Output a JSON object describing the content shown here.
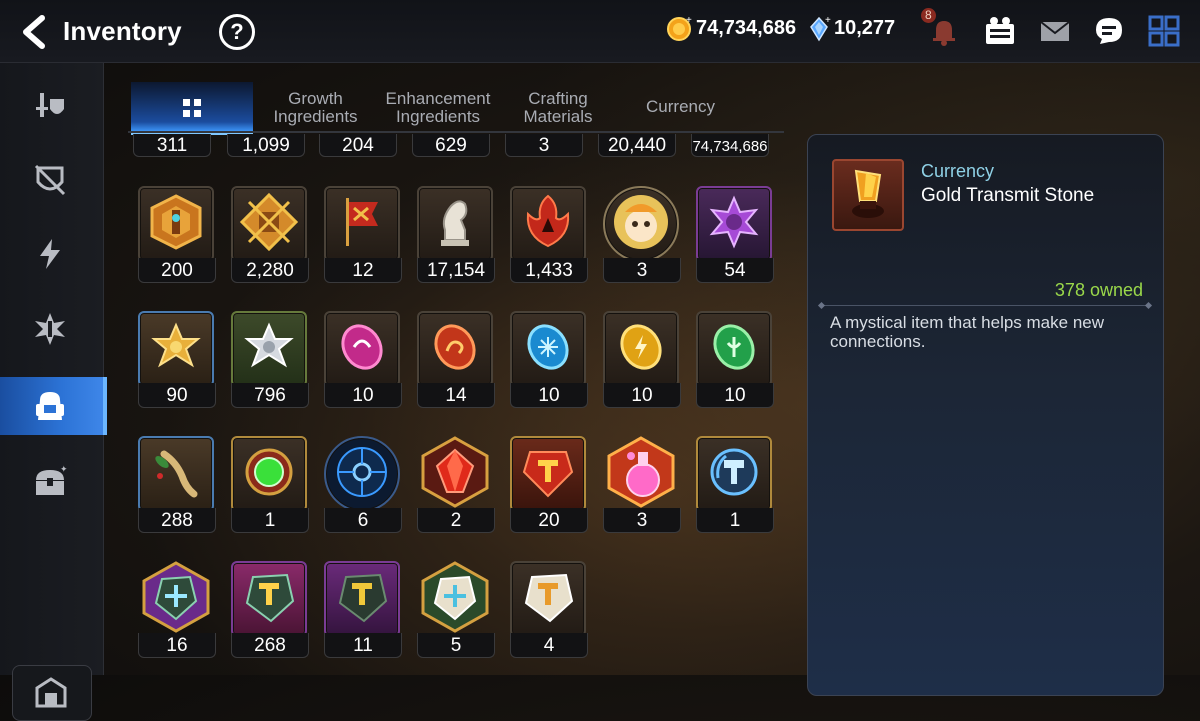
{
  "header": {
    "title": "Inventory",
    "help": "?",
    "currencies": [
      {
        "icon": "gold-coin-icon",
        "value": "74,734,686"
      },
      {
        "icon": "crystal-icon",
        "value": "10,277"
      }
    ],
    "notification_badge": "8",
    "icons": [
      "bell-icon",
      "friends-icon",
      "mail-icon",
      "chat-icon",
      "menu-grid-icon"
    ]
  },
  "sidebar": {
    "items": [
      {
        "icon": "equipment-icon",
        "active": false
      },
      {
        "icon": "artifact-icon",
        "active": false
      },
      {
        "icon": "catalyst-icon",
        "active": false
      },
      {
        "icon": "hero-material-icon",
        "active": false
      },
      {
        "icon": "bag-icon",
        "active": true
      },
      {
        "icon": "chest-icon",
        "active": false
      }
    ],
    "bottom_icon": "storage-icon"
  },
  "tabs": [
    {
      "label": "",
      "icon": "grid-icon",
      "active": true
    },
    {
      "label": "Growth\nIngredients",
      "active": false
    },
    {
      "label": "Enhancement\nIngredients",
      "active": false
    },
    {
      "label": "Crafting\nMaterials",
      "active": false
    },
    {
      "label": "Currency",
      "active": false
    }
  ],
  "grid": {
    "top_row": [
      "311",
      "1,099",
      "204",
      "629",
      "3",
      "20,440",
      "74,734,686"
    ],
    "rows": [
      [
        {
          "icon": "gold-shield-medal-icon",
          "count": "200"
        },
        {
          "icon": "fist-emblem-icon",
          "count": "2,280"
        },
        {
          "icon": "banner-icon",
          "count": "12"
        },
        {
          "icon": "knight-chess-icon",
          "count": "17,154"
        },
        {
          "icon": "red-flame-emblem-icon",
          "count": "1,433"
        },
        {
          "icon": "mascot-portrait-icon",
          "count": "3"
        },
        {
          "icon": "purple-flower-icon",
          "count": "54"
        }
      ],
      [
        {
          "icon": "gold-flower-icon",
          "count": "90"
        },
        {
          "icon": "silver-flower-icon",
          "count": "796"
        },
        {
          "icon": "pink-rune-icon",
          "count": "10"
        },
        {
          "icon": "red-rune-icon",
          "count": "14"
        },
        {
          "icon": "blue-rune-icon",
          "count": "10"
        },
        {
          "icon": "yellow-rune-icon",
          "count": "10"
        },
        {
          "icon": "green-rune-icon",
          "count": "10"
        }
      ],
      [
        {
          "icon": "root-herb-icon",
          "count": "288"
        },
        {
          "icon": "green-gem-ring-icon",
          "count": "1"
        },
        {
          "icon": "blue-sigil-icon",
          "count": "6"
        },
        {
          "icon": "red-crystal-icon",
          "count": "2"
        },
        {
          "icon": "red-hammer-stone-icon",
          "count": "20"
        },
        {
          "icon": "pink-potion-icon",
          "count": "3"
        },
        {
          "icon": "reforge-hammer-icon",
          "count": "1"
        }
      ],
      [
        {
          "icon": "purple-stone-icon",
          "count": "16"
        },
        {
          "icon": "pink-hammer-stone-icon",
          "count": "268"
        },
        {
          "icon": "dark-hammer-stone-icon",
          "count": "11"
        },
        {
          "icon": "white-stone-icon",
          "count": "5"
        },
        {
          "icon": "white-hammer-stone-icon",
          "count": "4"
        }
      ]
    ]
  },
  "detail": {
    "icon": "gold-transmit-stone-icon",
    "category": "Currency",
    "name": "Gold Transmit Stone",
    "owned": "378 owned",
    "description": "A mystical item that helps make new connections."
  }
}
